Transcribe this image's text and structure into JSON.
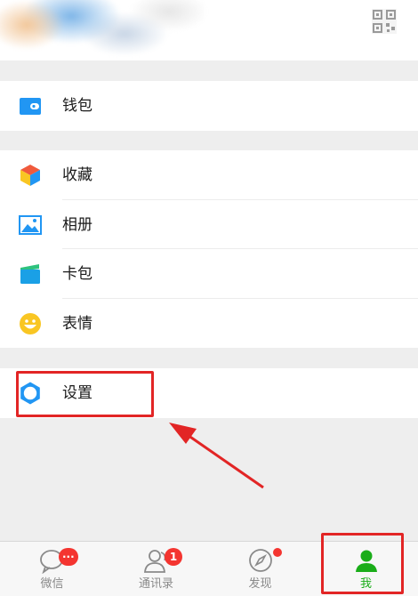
{
  "menu": {
    "wallet": {
      "label": "钱包",
      "icon": "wallet-icon",
      "color": "#2196f3"
    },
    "favorites": {
      "label": "收藏",
      "icon": "favorites-cube-icon"
    },
    "album": {
      "label": "相册",
      "icon": "album-icon",
      "color": "#2196f3"
    },
    "cards": {
      "label": "卡包",
      "icon": "card-wallet-icon",
      "color": "#1aa0e6"
    },
    "stickers": {
      "label": "表情",
      "icon": "smiley-icon",
      "color": "#f9c623"
    },
    "settings": {
      "label": "设置",
      "icon": "gear-icon",
      "color": "#2196f3"
    }
  },
  "tabbar": {
    "chats": {
      "label": "微信",
      "badge": "···",
      "icon": "chat-bubble-icon"
    },
    "contacts": {
      "label": "通讯录",
      "badge": "1",
      "icon": "contacts-icon"
    },
    "discover": {
      "label": "发现",
      "icon": "compass-icon"
    },
    "me": {
      "label": "我",
      "icon": "person-icon",
      "active": true
    }
  },
  "colors": {
    "accent_green": "#1aad19",
    "badge_red": "#f43530",
    "annotation_red": "#e22525"
  }
}
